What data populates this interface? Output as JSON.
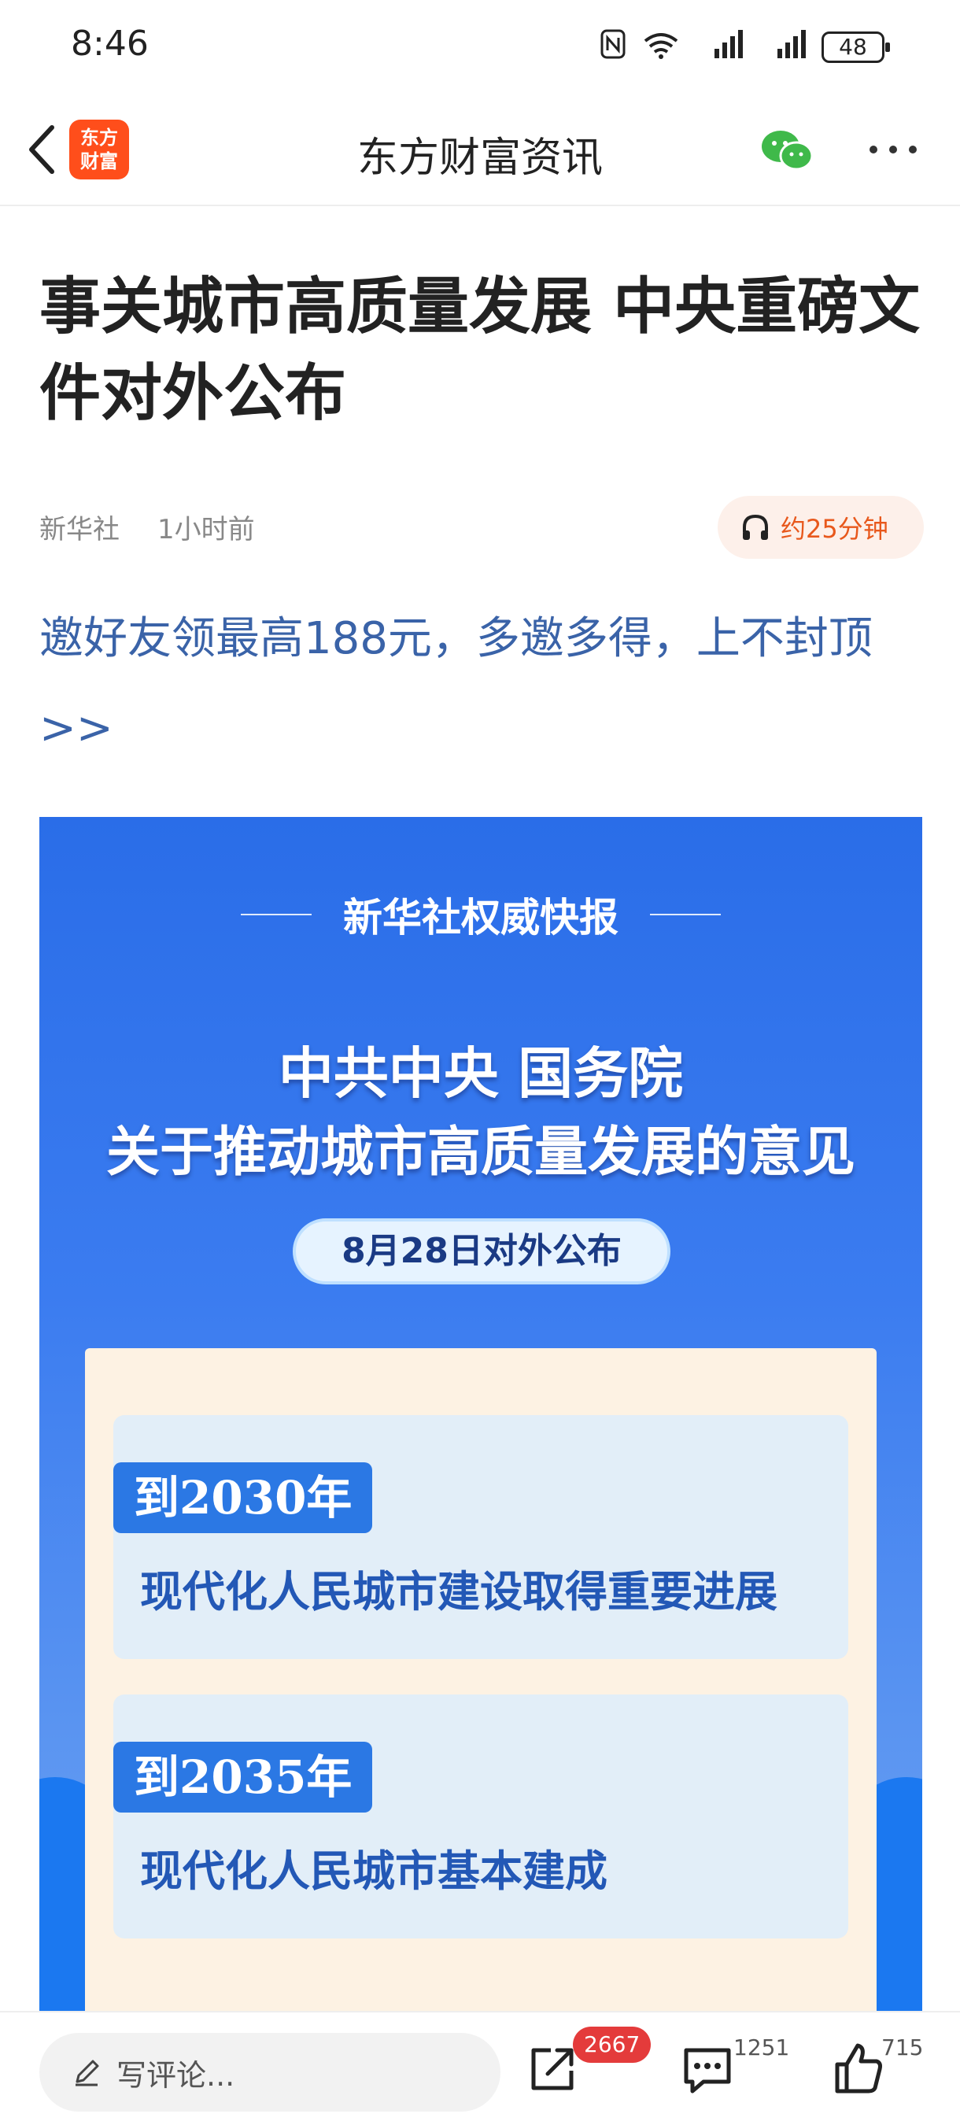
{
  "status_bar": {
    "time": "8:46",
    "battery": "48",
    "signal1": "4G",
    "signal2": "4G",
    "wifi_label": "6"
  },
  "nav": {
    "logo_line1": "东方",
    "logo_line2": "财富",
    "title": "东方财富资讯"
  },
  "article": {
    "headline": "事关城市高质量发展 中央重磅文件对外公布",
    "source": "新华社",
    "time": "1小时前",
    "audio_label": "约25分钟",
    "promo": "邀好友领最高188元，多邀多得，上不封顶>>"
  },
  "poster": {
    "kicker": "新华社权威快报",
    "title_line1": "中共中央  国务院",
    "title_line2": "关于推动城市高质量发展的意见",
    "date_pill": "8月28日对外公布",
    "goals": [
      {
        "year": "到2030年",
        "text": "现代化人民城市建设取得重要进展"
      },
      {
        "year": "到2035年",
        "text": "现代化人民城市基本建成"
      }
    ]
  },
  "bottom_bar": {
    "comment_placeholder": "写评论...",
    "share_count": "2667",
    "comment_count": "1251",
    "like_count": "715"
  },
  "colors": {
    "brand_orange": "#ff4e1b",
    "link_blue": "#3a63a8",
    "badge_red": "#e43b3b",
    "poster_blue": "#2a6de8"
  }
}
